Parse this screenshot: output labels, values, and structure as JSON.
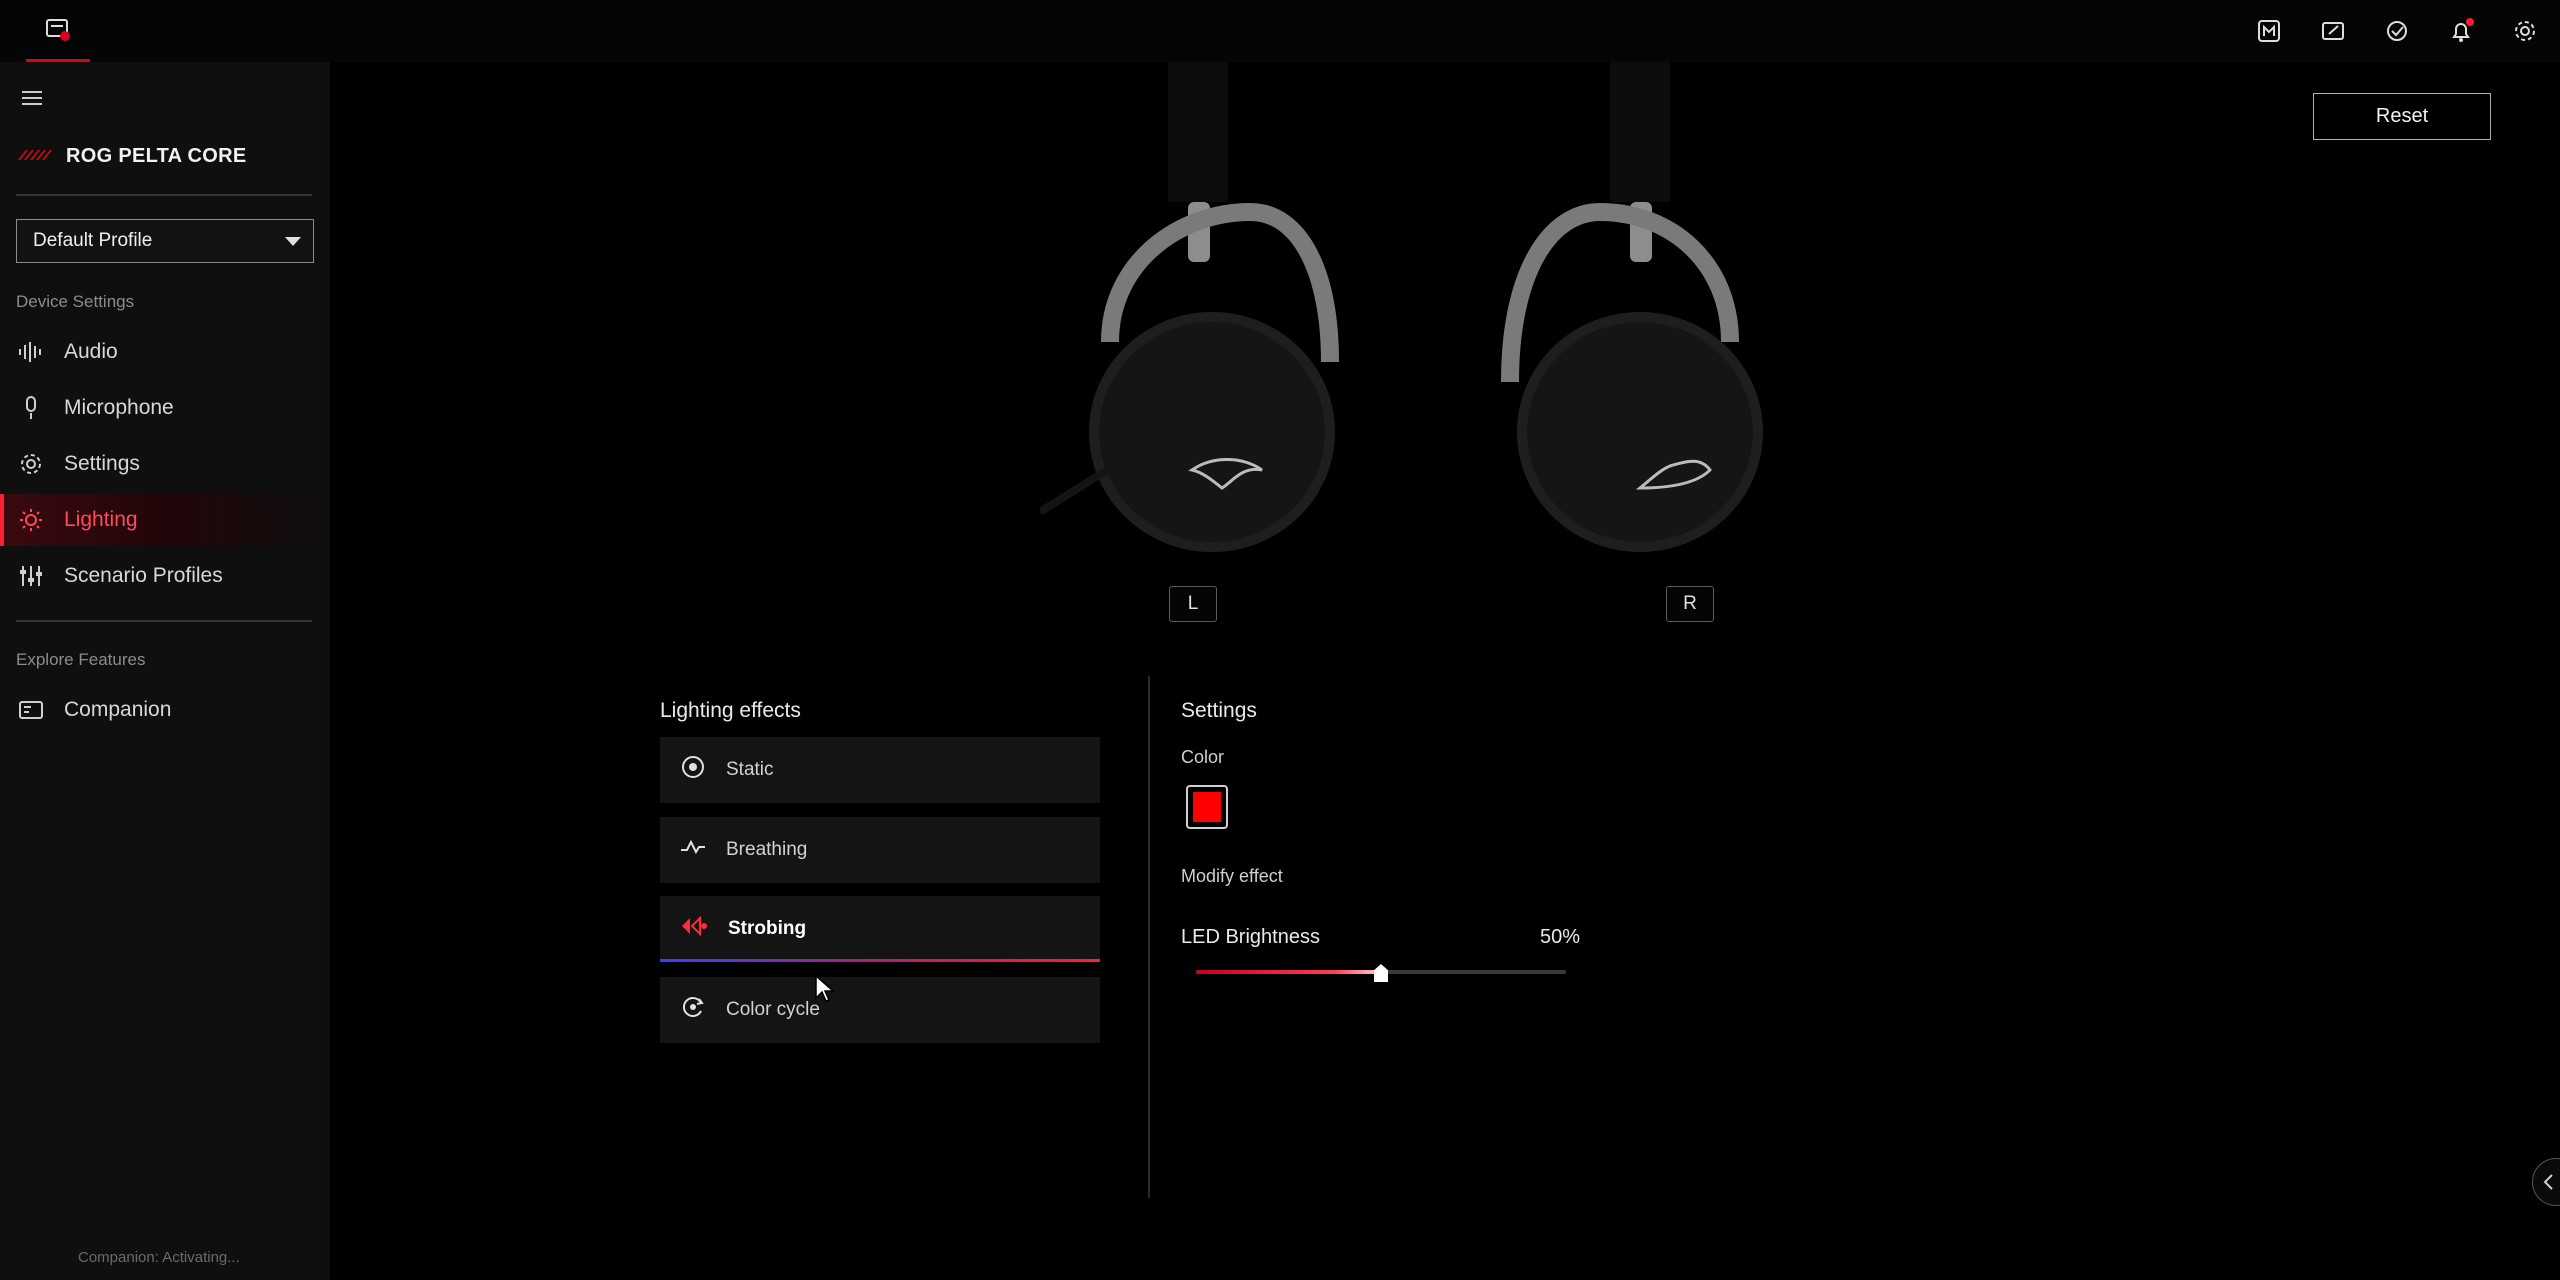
{
  "sidebar": {
    "device_name": "ROG PELTA CORE",
    "profile": "Default Profile",
    "device_settings_label": "Device Settings",
    "items": [
      {
        "label": "Audio",
        "icon": "audio-waveform-icon"
      },
      {
        "label": "Microphone",
        "icon": "microphone-icon"
      },
      {
        "label": "Settings",
        "icon": "gear-icon"
      },
      {
        "label": "Lighting",
        "icon": "lighting-sun-icon",
        "active": true
      },
      {
        "label": "Scenario Profiles",
        "icon": "sliders-icon"
      }
    ],
    "explore_label": "Explore Features",
    "explore_items": [
      {
        "label": "Companion",
        "icon": "companion-icon"
      }
    ],
    "footer": "Companion: Activating..."
  },
  "main": {
    "reset_label": "Reset",
    "left_tag": "L",
    "right_tag": "R",
    "lighting_effects_title": "Lighting effects",
    "effects": [
      {
        "label": "Static",
        "icon": "static-target-icon"
      },
      {
        "label": "Breathing",
        "icon": "breathing-wave-icon"
      },
      {
        "label": "Strobing",
        "icon": "strobing-icon",
        "active": true
      },
      {
        "label": "Color cycle",
        "icon": "color-cycle-icon"
      }
    ],
    "settings_title": "Settings",
    "color_label": "Color",
    "color_value": "#ff0000",
    "modify_label": "Modify effect",
    "brightness_label": "LED Brightness",
    "brightness_value": "50%",
    "brightness_fraction": 0.5
  },
  "colors": {
    "accent": "#ff1e33",
    "background": "#000000",
    "sidebar": "#0f0f0f"
  }
}
